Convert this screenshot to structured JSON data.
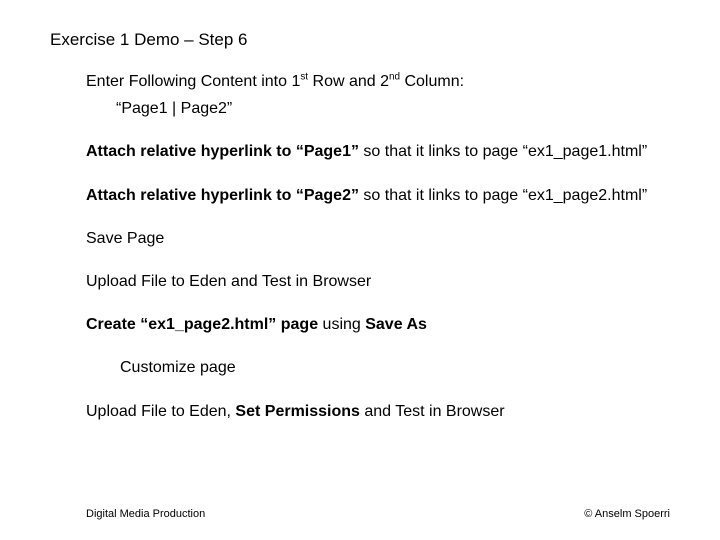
{
  "title": "Exercise 1 Demo – Step 6",
  "p1": {
    "lead": "Enter Following Content into 1",
    "sup1": "st",
    "mid": " Row and 2",
    "sup2": "nd",
    "tail": " Column:",
    "indent": "“Page1 | Page2”"
  },
  "p2": {
    "b": "Attach relative hyperlink to “Page1”",
    "rest": " so that it links to page “ex1_page1.html”"
  },
  "p3": {
    "b": "Attach relative hyperlink to “Page2”",
    "rest": " so that it links to page “ex1_page2.html”"
  },
  "p4": "Save Page",
  "p5": "Upload File to Eden and Test in Browser",
  "p6": {
    "b1": "Create “ex1_page2.html” page",
    "mid": " using ",
    "b2": "Save As"
  },
  "p7": "Customize page",
  "p8": {
    "a": "Upload File to Eden, ",
    "b": "Set Permissions",
    "c": " and Test in Browser"
  },
  "footer_left": "Digital Media Production",
  "footer_right": "© Anselm Spoerri"
}
